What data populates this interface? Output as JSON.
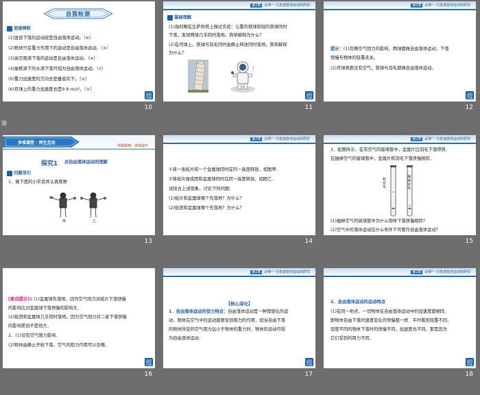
{
  "top_left_label": "治",
  "header_text": "必修一 匀变速直线运动的研究",
  "header_chapter": "第2章",
  "back_button": "返回 目录",
  "slides": [
    {
      "number": "10",
      "title": "自我检测",
      "section": "思维辨析",
      "lines": [
        "(1)竖直下落的运动就是自由落体运动。（",
        "(2)物体只在重力作用下的运动是自由落体运动。（",
        "(3)高空雨滴下落的运动是自由落体运动。（",
        "(4)屋檐滴下的水滴下落可视为自由落体运动。（",
        "(5)重力加速度的方向总是垂直向下。（",
        "(6)月球上的重力加速度也是9.8 m/s²。（"
      ],
      "marks": [
        "×",
        "×",
        "×",
        "√",
        "×",
        "×"
      ]
    },
    {
      "number": "11",
      "section": "基础理解",
      "lines": [
        "(1)伽利略在比萨斜塔上做过实验：让重的铁球和轻的铁球同时",
        "下落，发现两球几乎同时落地。简单解释为什么？",
        "(2)在月球上，铁球与羽毛同时由静止释放同时落地。简单解释",
        "为什么？"
      ]
    },
    {
      "number": "12",
      "hint_label": "提示：",
      "lines": [
        "(1)忽略空气阻力的影响，两球都做自由落体运动，下落",
        "快慢与物体的轻重无关。",
        "(2)月球表面没有空气，铁球与羽毛都做自由落体运动。"
      ]
    },
    {
      "number": "13",
      "banner": "多维课堂 · 师生互动",
      "tag": "突破疑难 · 讲练提升",
      "explore_label": "探究1",
      "explore_title": "对自由落体运动的理解",
      "section": "问题导引",
      "lines": [
        "1．做下面的小实验并认真观察"
      ],
      "fig_labels": [
        "甲",
        "乙"
      ]
    },
    {
      "number": "14",
      "lines": [
        "①将一张纸片和一个金属球同时在同一高度释放，如图甲．",
        "②将纸片揉成团和金属球同时在同一高度释放，如图乙．",
        "试结合上述现象，讨论下列问题：",
        "(1)纸片和金属球哪个先落地？为什么？",
        "(2)纸团和金属球哪个先落地？为什么？"
      ]
    },
    {
      "number": "15",
      "lines": [
        "2．如图所示，在有空气的玻璃管中，金属片比羽毛下落得快．",
        "在抽掉空气的玻璃管中，金属片和羽毛下落快慢相同．",
        "(1)抽掉空气的玻璃管中为什么物体下落快慢相同？",
        "(2)空气中的落体运动在什么条件下可看作自由落体运动？"
      ],
      "tube_labels": [
        "有空气",
        "抽掉空气"
      ]
    },
    {
      "number": "16",
      "hint_label": "[要点提示]",
      "lines": [
        "1.(1)金属球先落地，因为空气阻力对纸片下落快慢",
        "的影响比对金属球下落快慢的影响大．",
        "(2)纸团和金属球几乎同时落地，因为空气阻力对二者下落快慢",
        "的影响差别不是很大．",
        "2．(1)没有空气阻力影响．",
        "(2)物体由静止开始下落，空气的阻力作用可以忽略．"
      ]
    },
    {
      "number": "17",
      "heading": "【核心深化】",
      "lead": "1．自由落体运动的受力特点：",
      "lines": [
        "自由落体运动是一种理想化的运",
        "动，物体在空气中的运动都要受到阻力的作用，但当自由下落",
        "的物体所受的空气阻力远小于物体的重力时，物体的运动可视",
        "为自由落体运动．"
      ]
    },
    {
      "number": "18",
      "lead": "2．自由落体运动的运动特点",
      "lines": [
        "(1)在同一地点，一切物体在自由落体运动中的加速度都相同．",
        "即物体自由下落时速度变化的快慢都一样．平时看到轻重不同、",
        "密度不同的物体下落时的快慢不同，加速度也不同，那是因为",
        "它们受到的阻力不同．"
      ]
    }
  ]
}
